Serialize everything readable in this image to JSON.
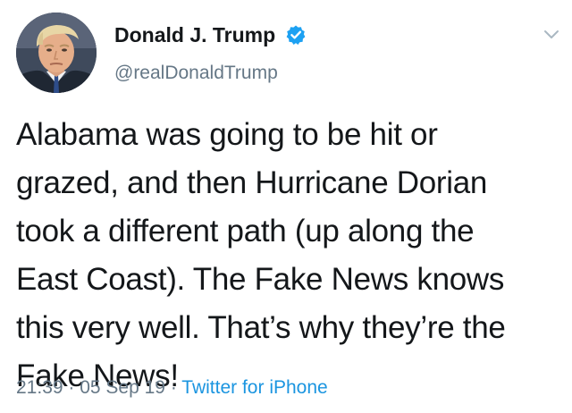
{
  "author": {
    "name": "Donald J. Trump",
    "handle": "@realDonaldTrump",
    "verified": true
  },
  "tweet": {
    "lines": [
      "Alabama was going to be hit or",
      "grazed, and then Hurricane Dorian",
      "took a different path (up along the",
      "East Coast). The Fake News knows",
      "this very well. That’s why they’re the",
      "Fake News!"
    ]
  },
  "meta": {
    "time": "21:39",
    "sep1": " · ",
    "date": "05 Sep 19",
    "sep2": " · ",
    "source": "Twitter for iPhone"
  },
  "icons": {
    "verified": "verified-badge-icon",
    "menu": "chevron-down-icon"
  },
  "colors": {
    "text": "#14171a",
    "secondary": "#657786",
    "link": "#1b95e0",
    "verified": "#1da1f2"
  }
}
